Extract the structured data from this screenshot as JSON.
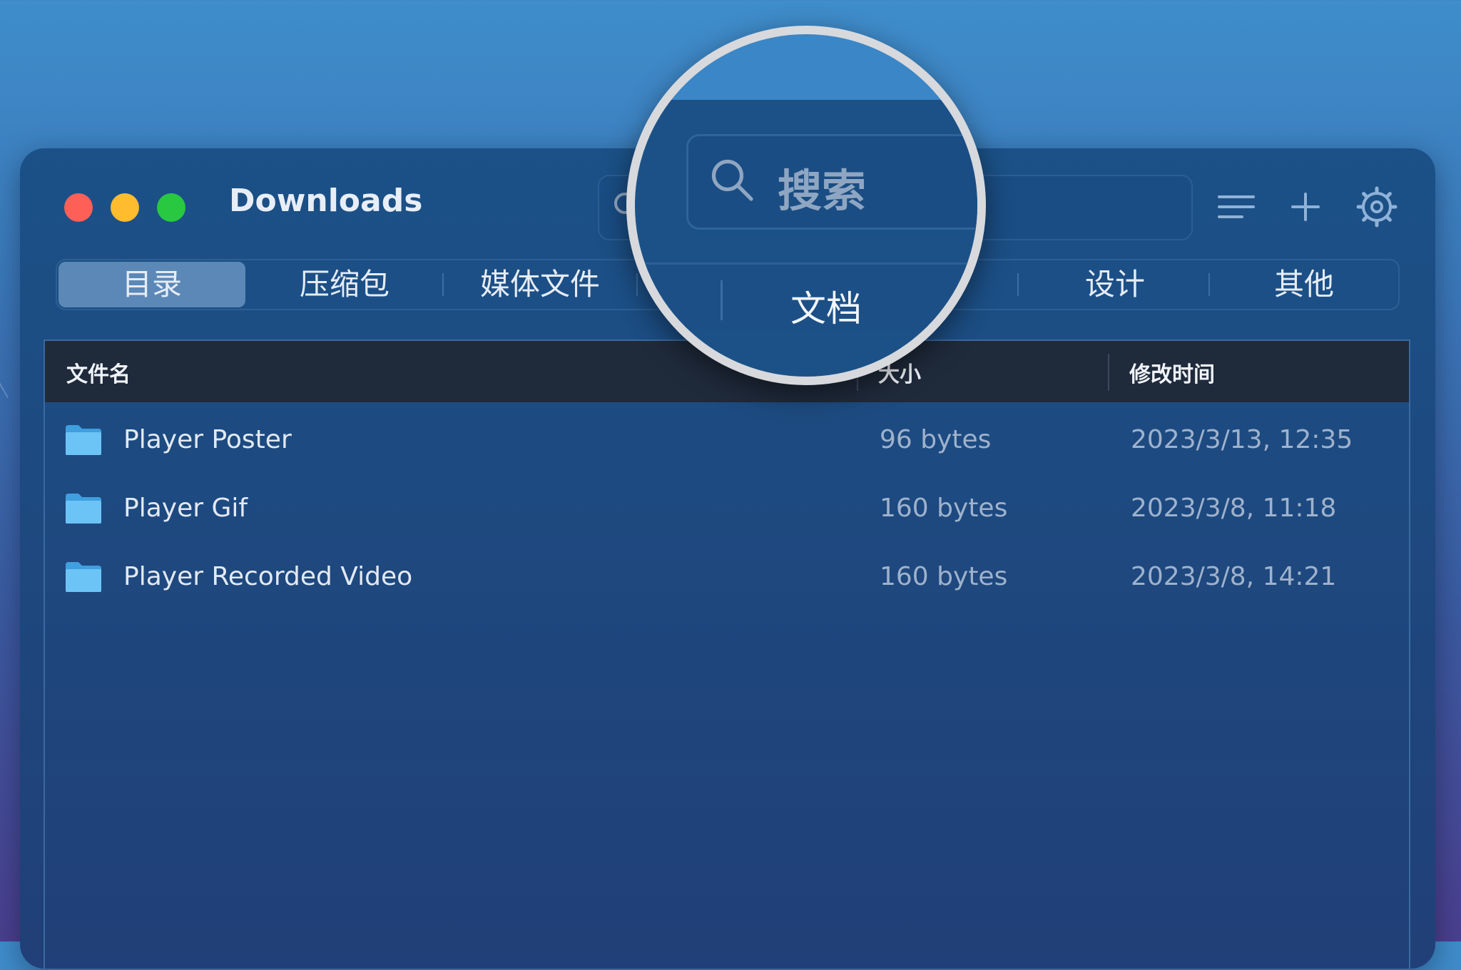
{
  "window": {
    "title": "Downloads",
    "traffic_lights": {
      "close_color": "#fe5f57",
      "minimize_color": "#febc2e",
      "zoom_color": "#28c840"
    }
  },
  "search": {
    "placeholder": "搜索",
    "icon": "search-icon"
  },
  "toolbar": {
    "menu_icon": "list-icon",
    "add_icon": "plus-icon",
    "settings_icon": "gear-icon"
  },
  "tabs": [
    {
      "label": "目录",
      "active": true
    },
    {
      "label": "压缩包",
      "active": false
    },
    {
      "label": "媒体文件",
      "active": false
    },
    {
      "label": "文档",
      "active": false
    },
    {
      "label": "设计",
      "active": false
    },
    {
      "label": "其他",
      "active": false
    }
  ],
  "table": {
    "columns": [
      "文件名",
      "大小",
      "修改时间"
    ],
    "rows": [
      {
        "name": "Player Poster",
        "size": "96 bytes",
        "modified": "2023/3/13, 12:35",
        "icon": "folder-icon"
      },
      {
        "name": "Player Gif",
        "size": "160 bytes",
        "modified": "2023/3/8, 11:18",
        "icon": "folder-icon"
      },
      {
        "name": "Player Recorded Video",
        "size": "160 bytes",
        "modified": "2023/3/8, 14:21",
        "icon": "folder-icon"
      }
    ]
  },
  "magnifier": {
    "search_placeholder": "搜索",
    "tab_label": "文档"
  },
  "colors": {
    "accent": "#5b88b7",
    "window_bg": "#1d4a80",
    "header_bg": "#1f2a3b",
    "folder": "#6cc4f6"
  }
}
